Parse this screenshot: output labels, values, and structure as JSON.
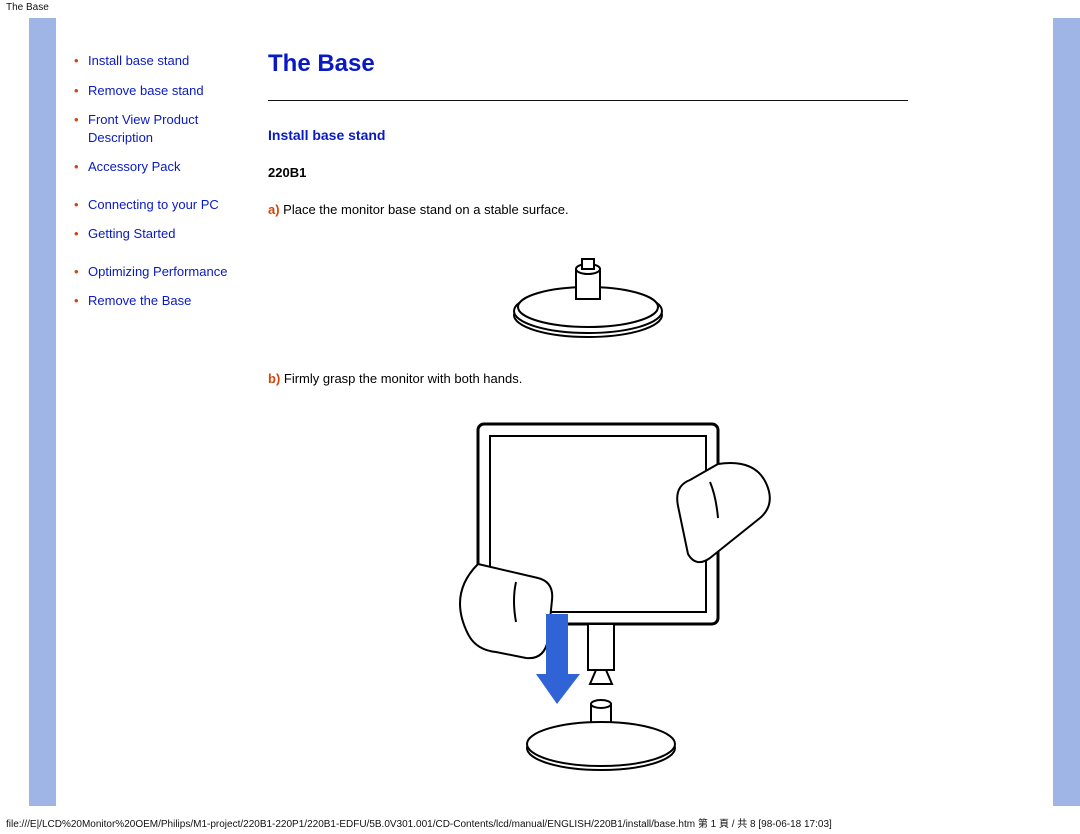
{
  "header_small": "The Base",
  "sidebar": {
    "items": [
      "Install base stand",
      "Remove base stand",
      "Front View Product Description",
      "Accessory Pack",
      "Connecting to your PC",
      "Getting Started",
      "Optimizing Performance",
      "Remove the Base"
    ]
  },
  "content": {
    "title": "The Base",
    "section_heading": "Install base stand",
    "model": "220B1",
    "step_a": {
      "tag": "a)",
      "text": " Place the monitor base stand on a stable surface."
    },
    "step_b": {
      "tag": "b)",
      "text": " Firmly grasp the monitor with both hands."
    }
  },
  "footer": "file:///E|/LCD%20Monitor%20OEM/Philips/M1-project/220B1-220P1/220B1-EDFU/5B.0V301.001/CD-Contents/lcd/manual/ENGLISH/220B1/install/base.htm 第 1 頁 / 共 8  [98-06-18 17:03]"
}
